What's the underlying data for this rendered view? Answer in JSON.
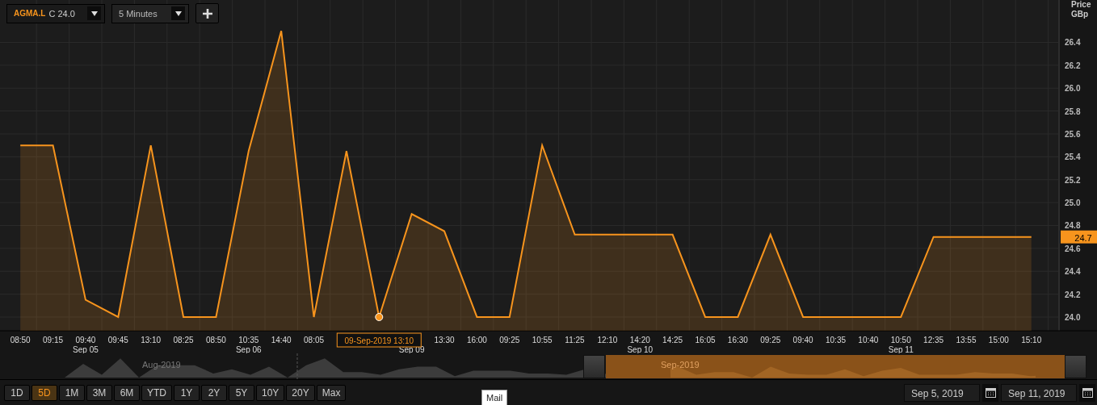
{
  "toolbar": {
    "quote": "C 24.0",
    "interval": "5 Minutes"
  },
  "y_axis_title": [
    "Price",
    "GBp"
  ],
  "last_price": "24.7",
  "chart_data": {
    "type": "area",
    "grid": true,
    "categories": [
      "08:50",
      "09:15",
      "09:40",
      "09:45",
      "13:10",
      "08:25",
      "08:50",
      "10:35",
      "14:40",
      "08:05",
      null,
      null,
      null,
      "13:30",
      "16:00",
      "09:25",
      "10:55",
      "11:25",
      "12:10",
      "14:20",
      "14:25",
      "16:05",
      "16:30",
      "09:25",
      "09:40",
      "10:35",
      "10:40",
      "10:50",
      "12:35",
      "13:55",
      "15:00",
      "15:10"
    ],
    "series": [
      {
        "name": "AGMA.L",
        "color": "#f7941d",
        "values": [
          25.5,
          25.5,
          24.15,
          24.0,
          25.5,
          24.0,
          24.0,
          25.45,
          26.5,
          24.0,
          25.45,
          24.0,
          24.9,
          24.75,
          24.0,
          24.0,
          25.5,
          24.72,
          24.72,
          24.72,
          24.72,
          24.0,
          24.0,
          24.72,
          24.0,
          24.0,
          24.0,
          24.0,
          24.7,
          24.7,
          24.7,
          24.7
        ]
      }
    ],
    "ylim": [
      23.88,
      26.77
    ],
    "yticks": [
      {
        "value": 24.0,
        "label": "24.0"
      },
      {
        "value": 24.2,
        "label": "24.2"
      },
      {
        "value": 24.4,
        "label": "24.4"
      },
      {
        "value": 24.6,
        "label": "24.6"
      },
      {
        "value": 24.8,
        "label": "24.8"
      },
      {
        "value": 25.0,
        "label": "25.0"
      },
      {
        "value": 25.2,
        "label": "25.2"
      },
      {
        "value": 25.4,
        "label": "25.4"
      },
      {
        "value": 25.6,
        "label": "25.6"
      },
      {
        "value": 25.8,
        "label": "25.8"
      },
      {
        "value": 26.0,
        "label": "26.0"
      },
      {
        "value": 26.2,
        "label": "26.2"
      },
      {
        "value": 26.4,
        "label": "26.4"
      }
    ],
    "annotations": [
      "09-Sep-2019 13:10"
    ]
  },
  "date_labels": [
    "Sep 05",
    "Sep 06",
    "Sep 09",
    "Sep 10",
    "Sep 11"
  ],
  "navigator": {
    "labels": [
      "Aug-2019",
      "Sep-2019"
    ]
  },
  "ranges": [
    {
      "label": "1D",
      "selected": false
    },
    {
      "label": "5D",
      "selected": true
    },
    {
      "label": "1M",
      "selected": false
    },
    {
      "label": "3M",
      "selected": false
    },
    {
      "label": "6M",
      "selected": false
    },
    {
      "label": "YTD",
      "selected": false
    },
    {
      "label": "1Y",
      "selected": false
    },
    {
      "label": "2Y",
      "selected": false
    },
    {
      "label": "5Y",
      "selected": false
    },
    {
      "label": "10Y",
      "selected": false
    },
    {
      "label": "20Y",
      "selected": false
    },
    {
      "label": "Max",
      "selected": false
    }
  ],
  "tooltip": "Mail",
  "date_from": "Sep 5, 2019",
  "date_to": "Sep 11, 2019"
}
